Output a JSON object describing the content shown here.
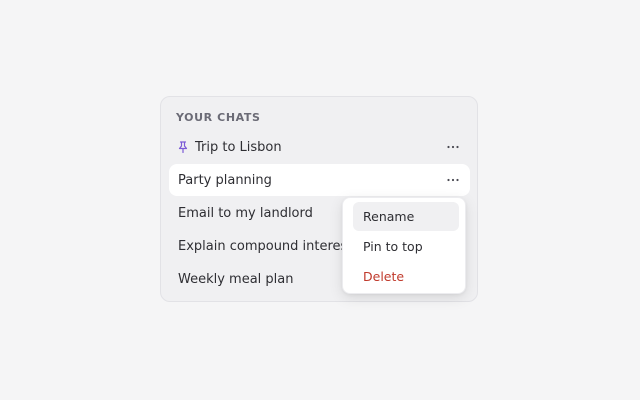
{
  "sidebar": {
    "header": "YOUR CHATS",
    "chats": [
      {
        "title": "Trip to Lisbon",
        "pinned": true
      },
      {
        "title": "Party planning",
        "active": true
      },
      {
        "title": "Email to my landlord"
      },
      {
        "title": "Explain compound interest"
      },
      {
        "title": "Weekly meal plan"
      }
    ]
  },
  "context_menu": {
    "items": [
      {
        "label": "Rename",
        "hovered": true
      },
      {
        "label": "Pin to top"
      },
      {
        "label": "Delete",
        "danger": true
      }
    ]
  },
  "colors": {
    "page_bg": "#f5f5f6",
    "panel_bg": "#f0f0f2",
    "active_row_bg": "#ffffff",
    "pin_accent": "#7b5bd6",
    "danger": "#c0392b"
  },
  "icons": {
    "pin": "pin-icon",
    "more": "more-horizontal-icon"
  }
}
